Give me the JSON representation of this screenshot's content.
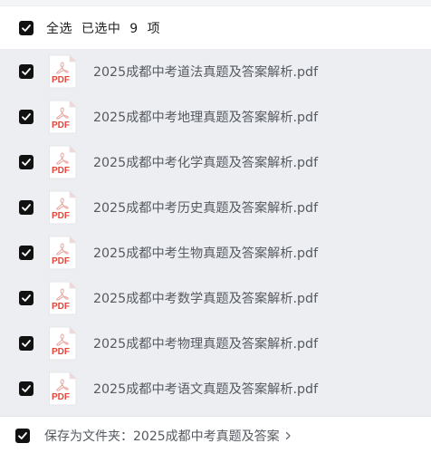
{
  "header": {
    "select_all_text": "全选  已选中  9  项"
  },
  "icons": {
    "file_icon_label": "PDF"
  },
  "files": [
    {
      "name": "2025成都中考道法真题及答案解析.pdf",
      "selected": true
    },
    {
      "name": "2025成都中考地理真题及答案解析.pdf",
      "selected": true
    },
    {
      "name": "2025成都中考化学真题及答案解析.pdf",
      "selected": true
    },
    {
      "name": "2025成都中考历史真题及答案解析.pdf",
      "selected": true
    },
    {
      "name": "2025成都中考生物真题及答案解析.pdf",
      "selected": true
    },
    {
      "name": "2025成都中考数学真题及答案解析.pdf",
      "selected": true
    },
    {
      "name": "2025成都中考物理真题及答案解析.pdf",
      "selected": true
    },
    {
      "name": "2025成都中考语文真题及答案解析.pdf",
      "selected": true
    }
  ],
  "footer": {
    "save_to_text": "保存为文件夹：2025成都中考真题及答案"
  },
  "colors": {
    "checkbox": "#111111",
    "list_background": "#edeef1",
    "pdf_red": "#e2463b",
    "text": "#555a61"
  }
}
